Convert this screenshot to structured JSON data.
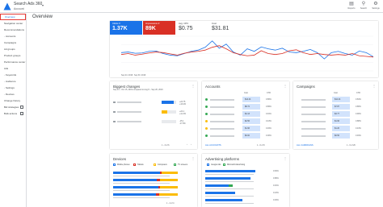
{
  "header": {
    "account_name": "Search Ads 360",
    "account_sub": "Account",
    "tools": [
      {
        "label": "Reports",
        "icon": "reports-icon",
        "glyph": "▤"
      },
      {
        "label": "Search",
        "icon": "search-icon",
        "glyph": "⚲"
      },
      {
        "label": "Settings",
        "icon": "gear-icon",
        "glyph": "⚙"
      }
    ]
  },
  "sidebar": {
    "items": [
      {
        "label": "Overview",
        "active": true
      },
      {
        "label": "Navigation center"
      },
      {
        "label": "Recommendations"
      },
      {
        "label": "Accounts",
        "prefix": "›"
      },
      {
        "label": "Campaigns"
      },
      {
        "label": "Ad groups"
      },
      {
        "label": "Product groups"
      },
      {
        "label": "Performance center"
      },
      {
        "label": "Ads"
      },
      {
        "label": "Keywords",
        "prefix": "›"
      },
      {
        "label": "Audience",
        "prefix": "›"
      },
      {
        "label": "Settings",
        "prefix": "›"
      },
      {
        "label": "Devices",
        "prefix": "›"
      },
      {
        "label": "Change history"
      },
      {
        "label": "Bid strategies",
        "external": true
      },
      {
        "label": "Bulk actions",
        "external": true
      }
    ]
  },
  "page": {
    "title": "Overview"
  },
  "overview": {
    "metrics": [
      {
        "label": "Clicks ▾",
        "value": "1.37K",
        "color": "#1a73e8"
      },
      {
        "label": "Impressions ▾",
        "value": "89K",
        "color": "#d93025"
      },
      {
        "label": "Avg. CPC",
        "value": "$0.75",
        "color": "#ffffff"
      },
      {
        "label": "Cost",
        "value": "$31.81",
        "color": "#ffffff"
      }
    ],
    "chart_data": {
      "type": "line",
      "series": [
        {
          "name": "Clicks",
          "color": "#1a73e8",
          "values": [
            58,
            60,
            56,
            57,
            62,
            63,
            55,
            50,
            48,
            55,
            62,
            66,
            75,
            95,
            72,
            85,
            60,
            50,
            70,
            62,
            76,
            70,
            66,
            72,
            60,
            58,
            62,
            68,
            58,
            38,
            58,
            62,
            55,
            50,
            63,
            58,
            45
          ]
        },
        {
          "name": "Impressions",
          "color": "#d93025",
          "values": [
            52,
            55,
            50,
            53,
            57,
            60,
            58,
            54,
            50,
            56,
            60,
            62,
            66,
            75,
            80,
            70,
            58,
            52,
            48,
            50,
            64,
            55,
            52,
            55,
            64,
            67,
            58,
            52,
            55,
            52,
            50,
            52,
            50,
            55,
            48,
            46,
            44
          ]
        }
      ],
      "ylim": [
        0,
        110
      ],
      "xlabels": [
        "Sep 24, 2019",
        "Sep 30, 2019"
      ]
    }
  },
  "biggest_changes": {
    "title": "Biggest changes",
    "subtitle": "Sep 24 – Oct 15, 2019 compared to Aug 8 – Sep 20, 2019",
    "rows": [
      {
        "text": "+24.75",
        "sub": "+16.2%",
        "color": "#1a73e8",
        "fill": 0.85
      },
      {
        "text": "+24.1",
        "sub": "+11.3%",
        "color": "#fbbc04",
        "fill": 0.4
      },
      {
        "text": "-15.1",
        "sub": "-17.8%",
        "color": "#dadce0",
        "fill": 0
      }
    ],
    "footer": "1 - 3 of 6"
  },
  "accounts": {
    "title": "Accounts",
    "headers": [
      "Cost",
      "CTR"
    ],
    "rows": [
      {
        "cost": "$14.44",
        "ctr": "0.86%",
        "status": "#34a853"
      },
      {
        "cost": "$8.72",
        "ctr": "0.89%",
        "status": "#34a853"
      },
      {
        "cost": "$4.13",
        "ctr": "0.91%",
        "status": "#34a853"
      },
      {
        "cost": "$2.56",
        "ctr": "0.43%",
        "status": "#fbbc04"
      },
      {
        "cost": "$1.96",
        "ctr": "0.49%",
        "status": "#fbbc04"
      },
      {
        "cost": "$0.00",
        "ctr": "0.00%",
        "status": "#34a853"
      }
    ],
    "footer_link": "ALL ACCOUNTS",
    "footer_count": "1 - 6 of 8"
  },
  "campaigns": {
    "title": "Campaigns",
    "headers": [
      "Cost",
      "CTR"
    ],
    "rows": [
      {
        "cost": "$12.44",
        "ctr": "0.84%"
      },
      {
        "cost": "$7.87",
        "ctr": "0.86%"
      },
      {
        "cost": "$3.77",
        "ctr": "0.90%"
      },
      {
        "cost": "$1.96",
        "ctr": "0.88%"
      },
      {
        "cost": "$1.20",
        "ctr": "0.43%"
      },
      {
        "cost": "$0.56",
        "ctr": "0.49%"
      }
    ],
    "footer_link": "ALL CAMPAIGNS",
    "footer_count": "1 - 6 of 26"
  },
  "devices": {
    "title": "Devices",
    "legend": [
      {
        "label": "Mobile phones",
        "color": "#1a73e8"
      },
      {
        "label": "Tablets",
        "color": "#d93025"
      },
      {
        "label": "Computers",
        "color": "#fbbc04"
      },
      {
        "label": "TV screens",
        "color": "#34a853"
      }
    ],
    "rows": [
      {
        "segments": [
          0.72,
          0.03,
          0.25,
          0.0
        ]
      },
      {
        "segments": [
          0.68,
          0.04,
          0.28,
          0.0
        ]
      },
      {
        "segments": [
          0.7,
          0.02,
          0.28,
          0.0
        ]
      },
      {
        "segments": [
          0.66,
          0.05,
          0.29,
          0.0
        ]
      }
    ],
    "footer": "1 - 4 of 4"
  },
  "platforms": {
    "title": "Advertising platforms",
    "legend": [
      {
        "label": "Google Ads",
        "color": "#1a73e8"
      },
      {
        "label": "Microsoft Advertising",
        "color": "#34a853"
      }
    ],
    "rows": [
      {
        "a": 0.78,
        "b": 0.0,
        "val": "0.84%"
      },
      {
        "a": 0.7,
        "b": 0.0,
        "val": "0.86%"
      },
      {
        "a": 0.36,
        "b": 0.06,
        "val": "0.91%"
      },
      {
        "a": 0.46,
        "b": 0.0,
        "val": "0.43%"
      },
      {
        "a": 0.58,
        "b": 0.0,
        "val": "0.49%"
      }
    ]
  }
}
